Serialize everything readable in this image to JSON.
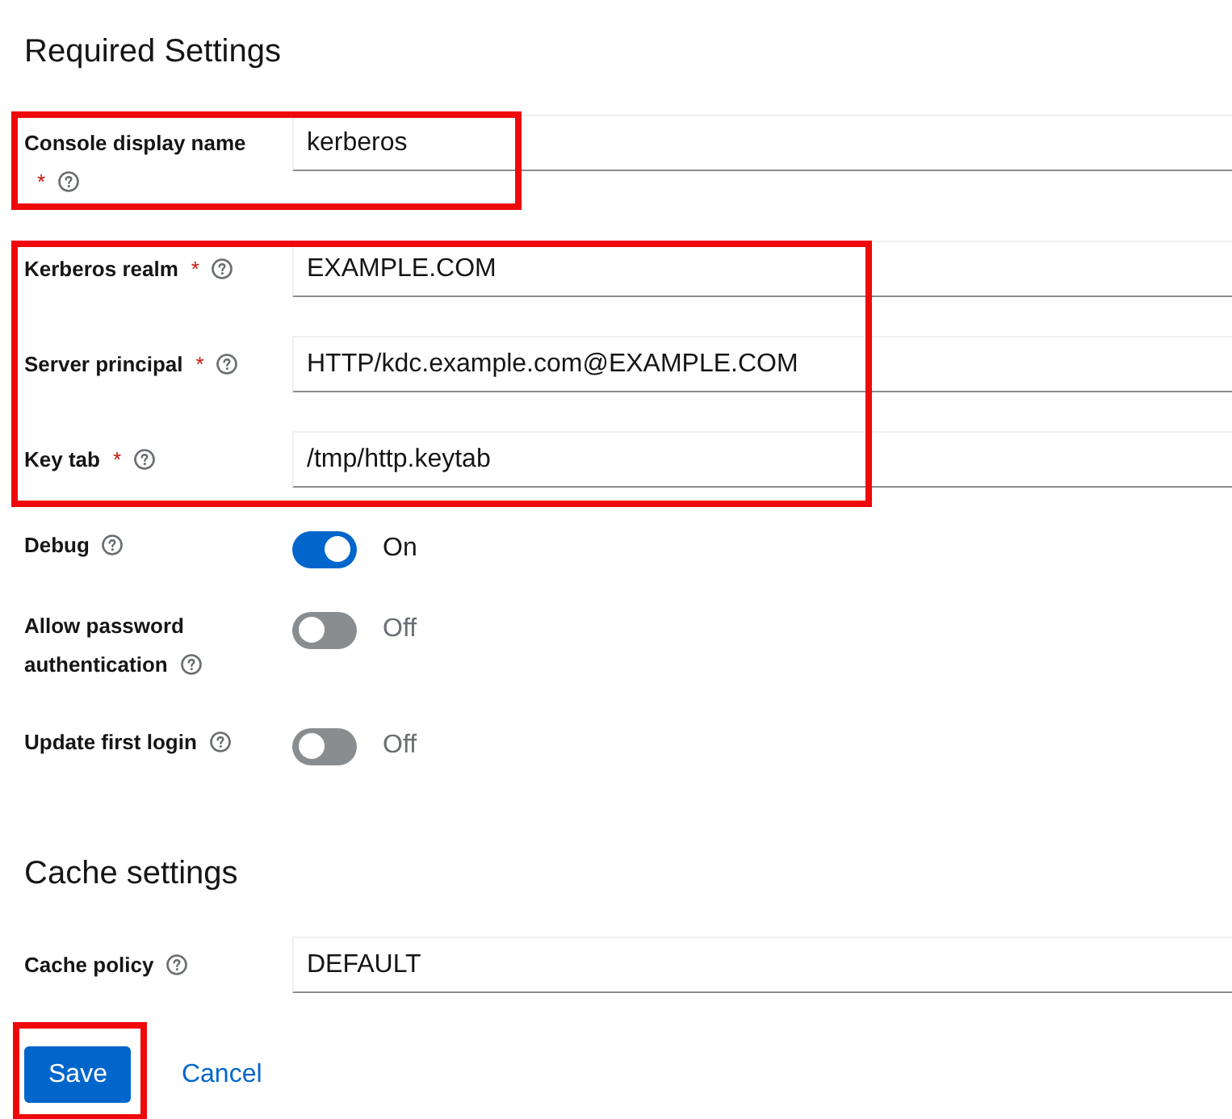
{
  "sections": [
    {
      "title": "Required Settings",
      "blocks": [
        {
          "highlighted": true,
          "fields": [
            {
              "kind": "text",
              "label": "Console display name",
              "required_mark": "*",
              "value": "kerberos"
            }
          ]
        },
        {
          "highlighted": true,
          "fields": [
            {
              "kind": "text",
              "label": "Kerberos realm",
              "required_mark": "*",
              "value": "EXAMPLE.COM"
            },
            {
              "kind": "text",
              "label": "Server principal",
              "required_mark": "*",
              "value": "HTTP/kdc.example.com@EXAMPLE.COM"
            },
            {
              "kind": "text",
              "label": "Key tab",
              "required_mark": "*",
              "value": "/tmp/http.keytab"
            }
          ]
        },
        {
          "highlighted": false,
          "fields": [
            {
              "kind": "switch",
              "label": "Debug",
              "on": true,
              "state_label": "On"
            },
            {
              "kind": "switch",
              "label": "Allow password authentication",
              "on": false,
              "state_label": "Off"
            },
            {
              "kind": "switch",
              "label": "Update first login",
              "on": false,
              "state_label": "Off"
            }
          ]
        }
      ]
    },
    {
      "title": "Cache settings",
      "blocks": [
        {
          "highlighted": false,
          "fields": [
            {
              "kind": "text",
              "label": "Cache policy",
              "value": "DEFAULT"
            }
          ]
        }
      ]
    }
  ],
  "actions": [
    {
      "kind": "primary",
      "label": "Save",
      "highlighted": true
    },
    {
      "kind": "link",
      "label": "Cancel",
      "highlighted": false
    }
  ]
}
